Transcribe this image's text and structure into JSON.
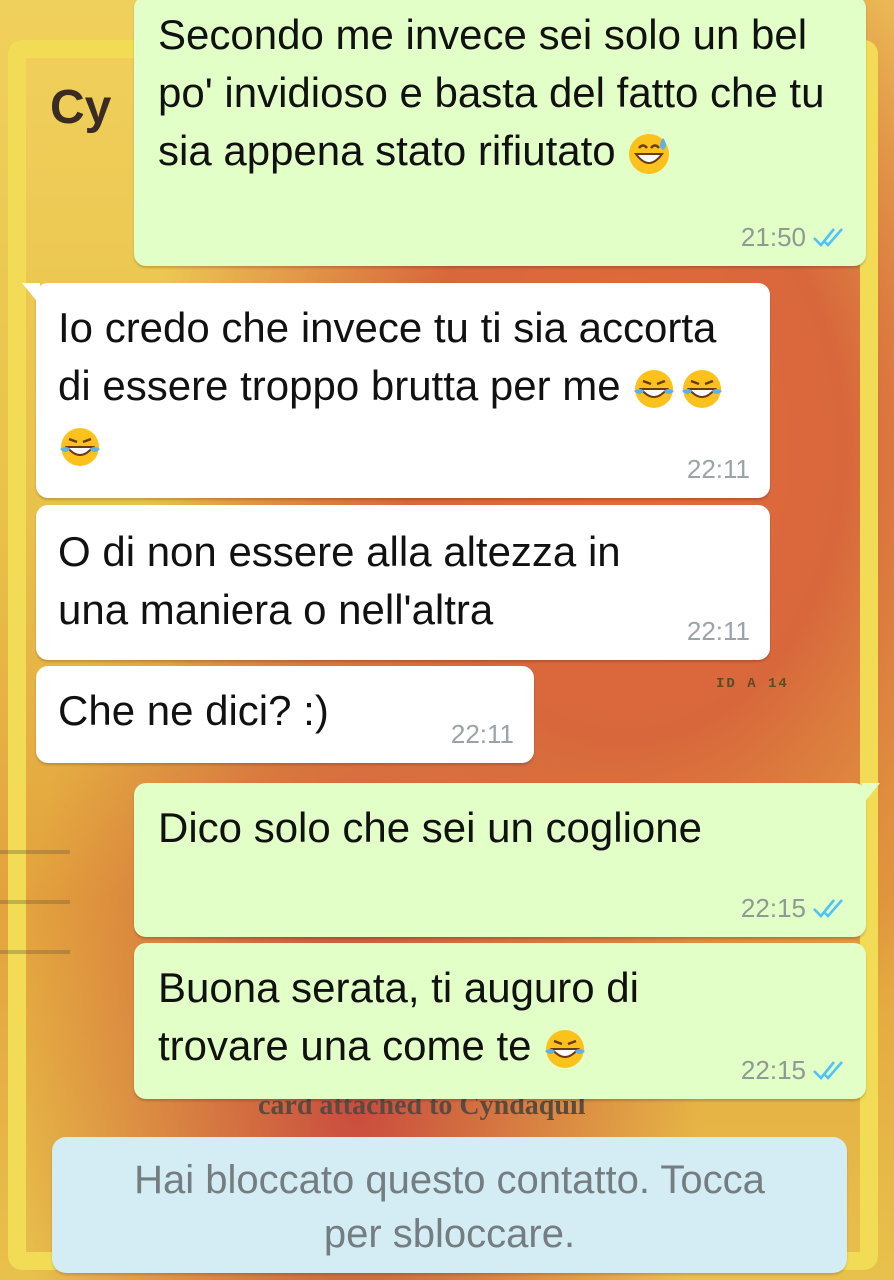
{
  "wallpaper": {
    "title_text": "Cy",
    "id_text": "ID A 14",
    "attached_text": "card attached to Cyndaquil"
  },
  "messages": [
    {
      "direction": "outgoing",
      "text": "Secondo me invece sei solo un bel po' invidioso e basta del fatto che tu sia appena stato rifiutato",
      "emojis": [
        "grinning-sweat-emoji"
      ],
      "time": "21:50",
      "status": "read"
    },
    {
      "direction": "incoming",
      "text": "Io credo che invece tu ti sia accorta di essere troppo brutta per me",
      "emojis": [
        "tears-of-joy-emoji",
        "tears-of-joy-emoji",
        "tears-of-joy-emoji"
      ],
      "time": "22:11"
    },
    {
      "direction": "incoming",
      "text": "O di non essere alla altezza in una maniera o nell'altra",
      "time": "22:11"
    },
    {
      "direction": "incoming",
      "text": "Che ne dici? :)",
      "time": "22:11"
    },
    {
      "direction": "outgoing",
      "text": "Dico solo che sei un coglione",
      "time": "22:15",
      "status": "read"
    },
    {
      "direction": "outgoing",
      "text": "Buona serata, ti auguro di trovare una come te",
      "emojis": [
        "tears-of-joy-emoji"
      ],
      "time": "22:15",
      "status": "read"
    }
  ],
  "system_notice": {
    "line1": "Hai bloccato questo contatto. Tocca",
    "line2": "per sbloccare."
  },
  "colors": {
    "outgoing_bubble": "#e1ffc7",
    "incoming_bubble": "#ffffff",
    "read_ticks": "#4fc3f7",
    "system_bubble": "#d4ecf4"
  }
}
